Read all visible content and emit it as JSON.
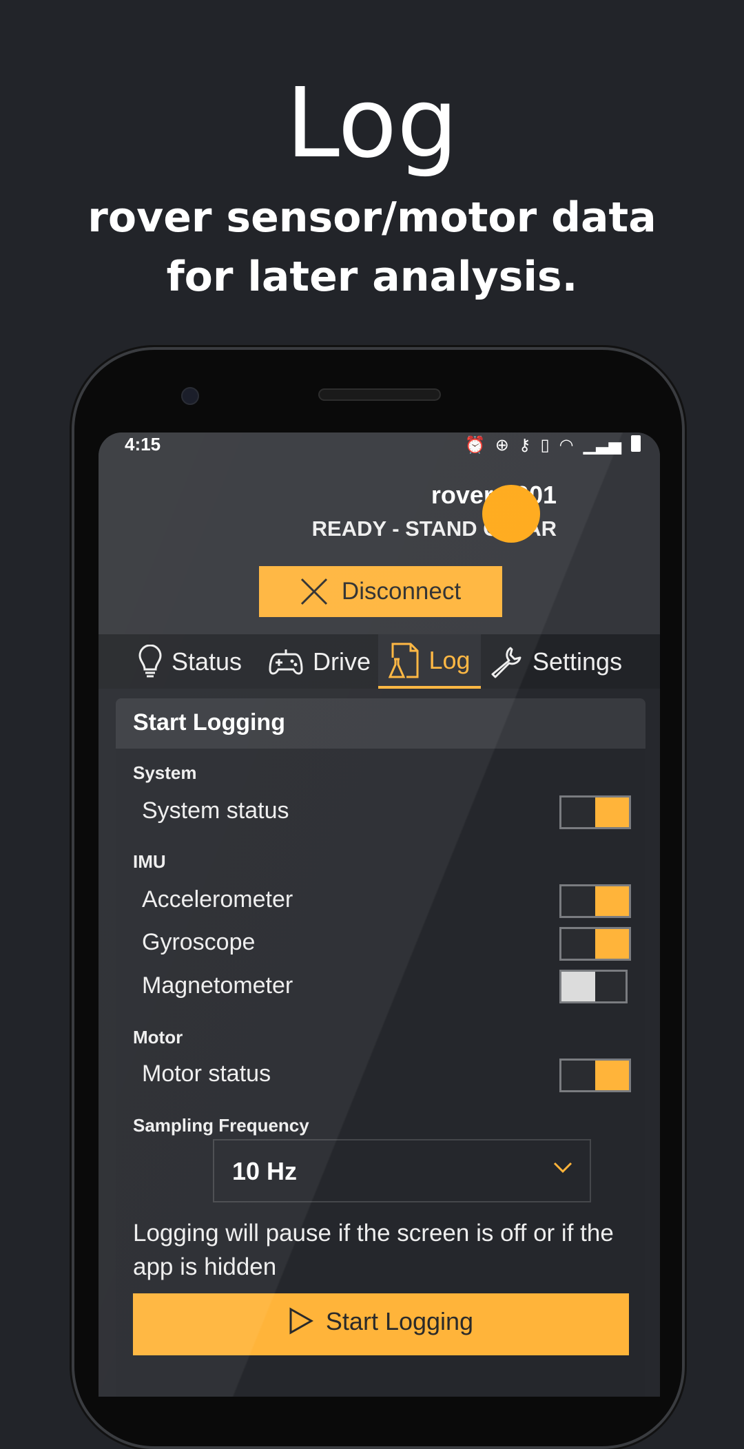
{
  "promo": {
    "title": "Log",
    "subtitle_lines": [
      "rover sensor/motor data",
      "for later analysis."
    ]
  },
  "status_bar": {
    "time": "4:15"
  },
  "device": {
    "name": "rover-0001",
    "state": "READY - STAND CLEAR",
    "indicator_color": "#ffa815"
  },
  "disconnect_label": "Disconnect",
  "tabs": [
    {
      "label": "Status",
      "icon": "lightbulb-icon"
    },
    {
      "label": "Drive",
      "icon": "gamepad-icon"
    },
    {
      "label": "Log",
      "icon": "flask-document-icon",
      "active": true
    },
    {
      "label": "Settings",
      "icon": "wrench-icon"
    }
  ],
  "card": {
    "title": "Start Logging",
    "sections": [
      {
        "label": "System",
        "items": [
          {
            "label": "System status",
            "on": true
          }
        ]
      },
      {
        "label": "IMU",
        "items": [
          {
            "label": "Accelerometer",
            "on": true
          },
          {
            "label": "Gyroscope",
            "on": true
          },
          {
            "label": "Magnetometer",
            "on": false
          }
        ]
      },
      {
        "label": "Motor",
        "items": [
          {
            "label": "Motor status",
            "on": true
          }
        ]
      }
    ],
    "sampling_label": "Sampling Frequency",
    "sampling_value": "10 Hz",
    "note": "Logging will pause if the screen is off or if the app is hidden",
    "start_label": "Start Logging"
  },
  "accent": "#ffb43a"
}
